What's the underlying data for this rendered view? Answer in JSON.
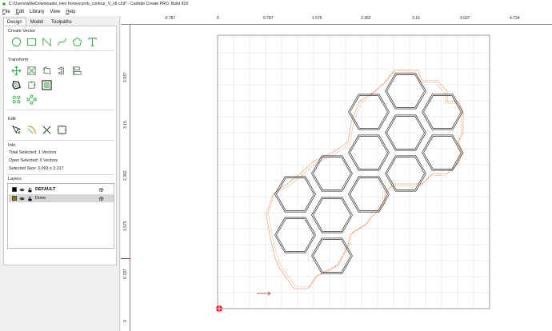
{
  "window": {
    "title": "C:/Users/willa/Downloads/_Hex honeycomb_contour_V_v8.c2d* - Carbide Create PRO, Build 816"
  },
  "menu": [
    {
      "key": "F",
      "rest": "ile"
    },
    {
      "key": "E",
      "rest": "dit"
    },
    {
      "key": "",
      "rest": "Library"
    },
    {
      "key": "",
      "rest": "View"
    },
    {
      "key": "H",
      "rest": "elp"
    }
  ],
  "tabs": [
    "Design",
    "Model",
    "Toolpaths"
  ],
  "sections": {
    "create_vector": "Create Vector",
    "transform": "Transform",
    "edit": "Edit",
    "info": "Info",
    "layers": "Layers"
  },
  "info": {
    "total_selected": "Total Selected:  1 Vectors",
    "open_selected": "Open Selected:  0 Vectors",
    "selected_size": "Selected Size:  3.069 x 3.317"
  },
  "layers": [
    {
      "name": "DEFAULT",
      "color": "#000000",
      "bold": true
    },
    {
      "name": "Done",
      "color": "#8a7a00",
      "bold": false
    }
  ],
  "ruler": {
    "h_labels": [
      "-0.787",
      "0",
      "0.787",
      "1.575",
      "2.362",
      "3.15",
      "3.937",
      "4.724"
    ],
    "v_labels": [
      "3.937",
      "3.15",
      "2.362",
      "1.575",
      "0.787",
      "0"
    ]
  },
  "colors": {
    "accent_green": "#3aa645",
    "contour_orange": "#e8763a",
    "origin_red": "#e02020",
    "hex_stroke": "#333333"
  }
}
